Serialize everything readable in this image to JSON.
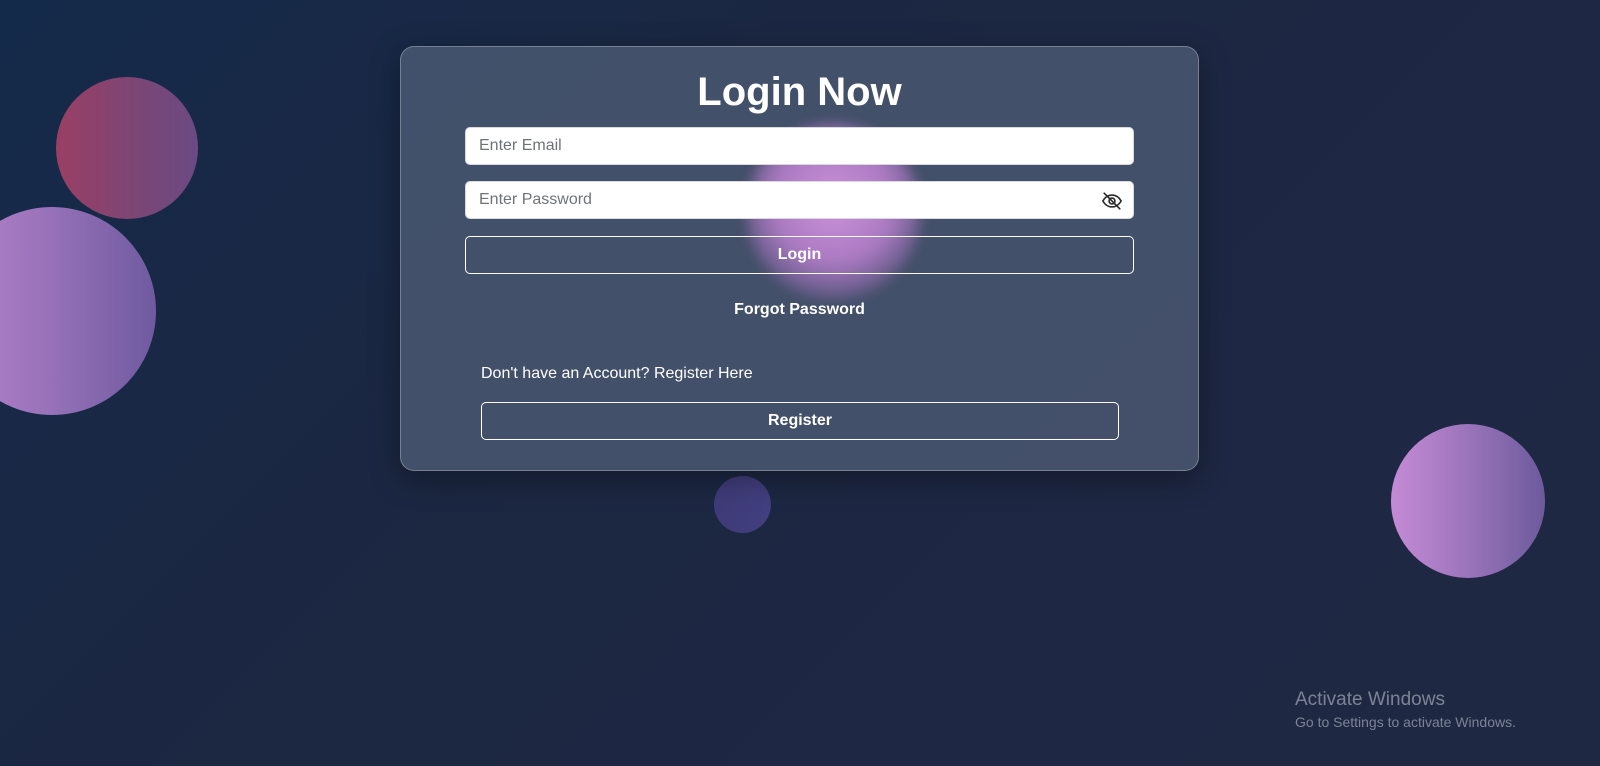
{
  "login_card": {
    "title": "Login Now",
    "email_placeholder": "Enter Email",
    "password_placeholder": "Enter Password",
    "login_button_label": "Login",
    "forgot_password_label": "Forgot Password",
    "register_prompt": "Don't have an Account? Register Here",
    "register_button_label": "Register",
    "password_toggle_icon": "eye-off-icon"
  },
  "watermark": {
    "title": "Activate Windows",
    "subtitle": "Go to Settings to activate Windows."
  },
  "colors": {
    "background": "#1c2743",
    "card": "#4a586f",
    "text": "#ffffff"
  }
}
